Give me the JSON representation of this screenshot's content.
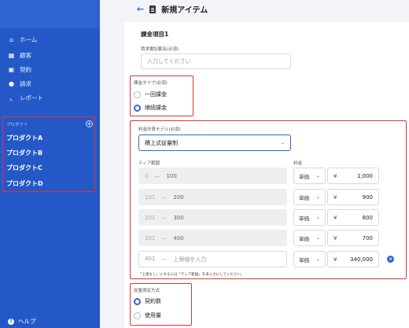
{
  "sidebar": {
    "nav": [
      {
        "label": "ホーム",
        "icon": "home-icon"
      },
      {
        "label": "顧客",
        "icon": "building-icon"
      },
      {
        "label": "契約",
        "icon": "contract-icon"
      },
      {
        "label": "請求",
        "icon": "invoice-icon"
      },
      {
        "label": "レポート",
        "icon": "chart-icon"
      }
    ],
    "products_heading": "プロダクト",
    "products": [
      "プロダクトA",
      "プロダクトB",
      "プロダクトC",
      "プロダクトD"
    ],
    "help": "ヘルプ"
  },
  "header": {
    "title": "新規アイテム"
  },
  "form": {
    "section_title": "課金項目1",
    "invoice_name_label": "請求書記載名(必須)",
    "invoice_name_placeholder": "入力してください",
    "billing_type_label": "課金タイプ(必須)",
    "billing_type_options": [
      "一回課金",
      "継続課金"
    ],
    "billing_type_selected": "継続課金",
    "pricing_model_label": "料金計算モデル(必須)",
    "pricing_model_value": "積上式従量制",
    "tier_range_label": "ティア範囲",
    "fee_label": "料金",
    "tiers": [
      {
        "from": "0",
        "sep": "—",
        "to": "100",
        "unit": "単価",
        "currency": "¥",
        "price": "1,000"
      },
      {
        "from": "101",
        "sep": "—",
        "to": "200",
        "unit": "単価",
        "currency": "¥",
        "price": "900"
      },
      {
        "from": "201",
        "sep": "—",
        "to": "300",
        "unit": "単価",
        "currency": "¥",
        "price": "800"
      },
      {
        "from": "301",
        "sep": "—",
        "to": "400",
        "unit": "単価",
        "currency": "¥",
        "price": "700"
      },
      {
        "from": "401",
        "sep": "—",
        "to": "上限値を入力",
        "unit": "単価",
        "currency": "¥",
        "price": "340,000"
      }
    ],
    "tier_note": "「上限なし」にするには「ティア範囲」を未入力にしてください。",
    "metering_label": "従量測定方式",
    "metering_options": [
      "契約数",
      "使用量"
    ],
    "metering_selected": "契約数"
  },
  "colors": {
    "sidebar": "#2458c6",
    "accent": "#2f66d4",
    "highlight": "#e0333c"
  }
}
